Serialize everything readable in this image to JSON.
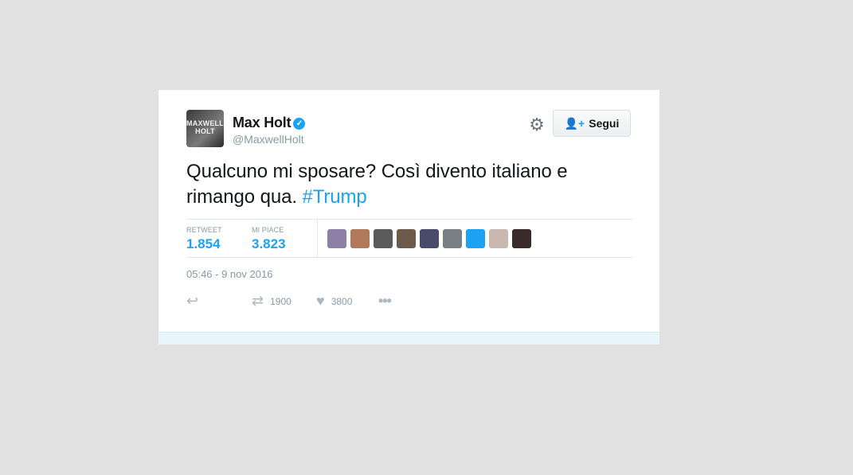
{
  "user": {
    "avatar_text_top": "MAXWELL",
    "avatar_text_bottom": "HOLT",
    "display_name": "Max Holt",
    "handle": "@MaxwellHolt",
    "verified": true
  },
  "header": {
    "gear_icon": "gear-icon",
    "follow_label": "Segui",
    "follow_icon": "add-user-icon"
  },
  "tweet": {
    "text": "Qualcuno mi sposare? Così divento italiano e rimango qua.",
    "hashtag": "#Trump"
  },
  "stats": {
    "retweet_label": "RETWEET",
    "retweet_value": "1.854",
    "likes_label": "MI PIACE",
    "likes_value": "3.823"
  },
  "likers": [
    "#8e7fa6",
    "#b07a5a",
    "#5a5a5a",
    "#6e5a4a",
    "#4a4a6a",
    "#7a7f86",
    "#1da1f2",
    "#c8b8b0",
    "#3a2a2a"
  ],
  "timestamp": "05:46 - 9 nov 2016",
  "actions": {
    "reply_icon": "reply-icon",
    "retweet_icon": "retweet-icon",
    "retweet_count": "1900",
    "like_icon": "heart-icon",
    "like_count": "3800",
    "more_icon": "more-icon"
  },
  "colors": {
    "accent": "#1da1f2",
    "background": "#e1e1e1",
    "card": "#ffffff"
  }
}
